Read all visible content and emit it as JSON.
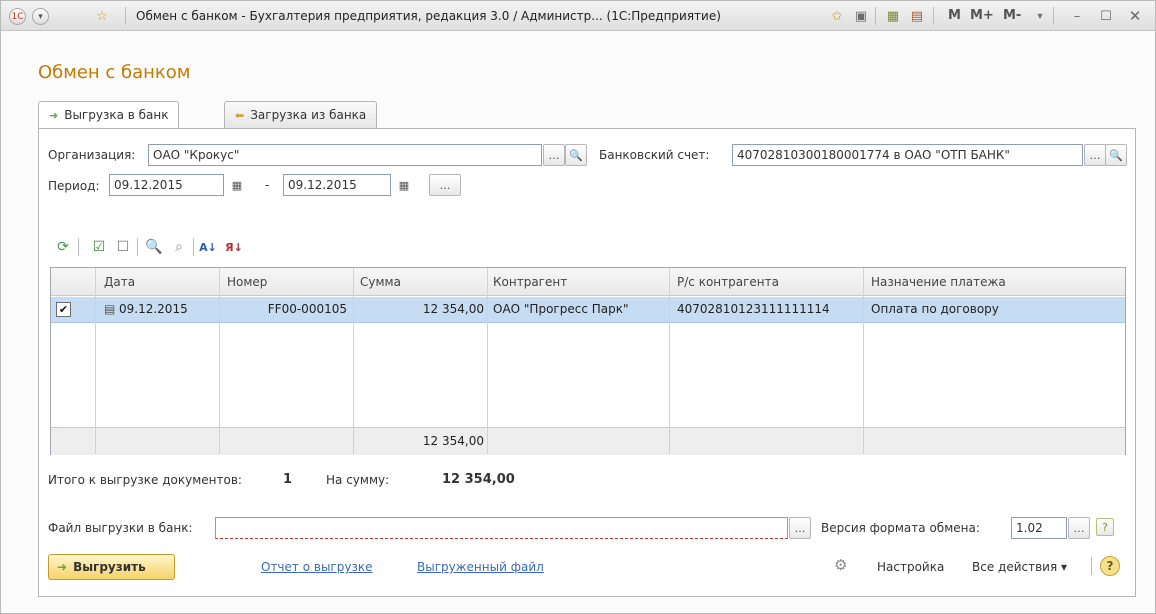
{
  "window": {
    "title": "Обмен с банком - Бухгалтерия предприятия, редакция 3.0 / Администр... (1С:Предприятие)",
    "m_buttons": [
      "M",
      "M+",
      "M-"
    ]
  },
  "form": {
    "title": "Обмен с банком",
    "tabs": [
      {
        "label": "Выгрузка в банк",
        "active": true
      },
      {
        "label": "Загрузка из банка",
        "active": false
      }
    ]
  },
  "filters": {
    "organization_label": "Организация:",
    "organization_value": "ОАО \"Крокус\"",
    "bank_account_label": "Банковский счет:",
    "bank_account_value": "40702810300180001774 в ОАО \"ОТП БАНК\"",
    "period_label": "Период:",
    "period_from": "09.12.2015",
    "period_dash": "-",
    "period_to": "09.12.2015"
  },
  "table": {
    "columns": [
      "Дата",
      "Номер",
      "Сумма",
      "Контрагент",
      "Р/с контрагента",
      "Назначение платежа"
    ],
    "rows": [
      {
        "checked": true,
        "date": "09.12.2015",
        "number": "FF00-000105",
        "sum": "12 354,00",
        "counterparty": "ОАО \"Прогресс Парк\"",
        "account": "40702810123111111114",
        "purpose": "Оплата по договору"
      }
    ],
    "total_sum": "12 354,00"
  },
  "summary": {
    "docs_label": "Итого к выгрузке документов:",
    "docs_count": "1",
    "sum_label": "На сумму:",
    "sum_value": "12 354,00"
  },
  "export": {
    "file_label": "Файл выгрузки в банк:",
    "file_value": "",
    "format_label": "Версия формата обмена:",
    "format_value": "1.02"
  },
  "actions": {
    "export_button": "Выгрузить",
    "report_link": "Отчет о выгрузке",
    "file_link": "Выгруженный файл",
    "settings_label": "Настройка",
    "all_actions_label": "Все действия"
  },
  "colors": {
    "title_orange": "#c67800",
    "selected_row": "#c6dcf2",
    "link_blue": "#3a6ab7"
  }
}
